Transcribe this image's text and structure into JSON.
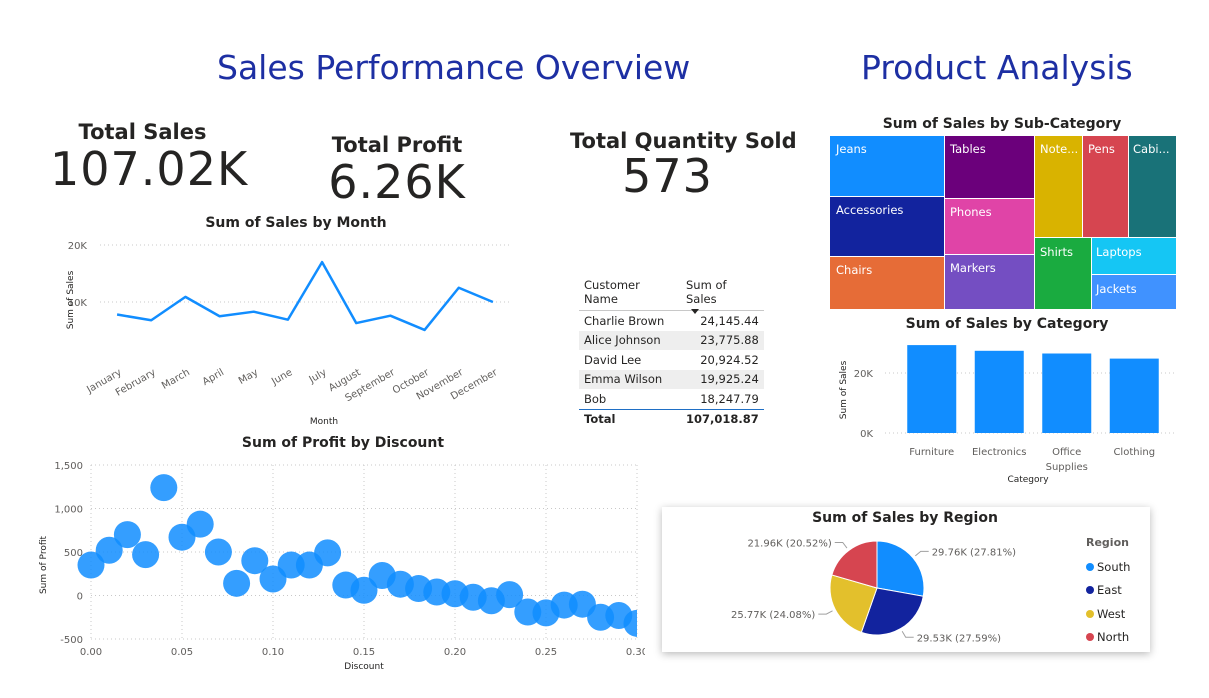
{
  "headers": {
    "left": "Sales Performance Overview",
    "right": "Product Analysis"
  },
  "cards": [
    {
      "label": "Total Sales",
      "value": "107.02K"
    },
    {
      "label": "Total Profit",
      "value": "6.26K"
    },
    {
      "label": "Total Quantity Sold",
      "value": "573"
    }
  ],
  "customer_table": {
    "headers": [
      "Customer Name",
      "Sum of Sales"
    ],
    "rows": [
      {
        "name": "Charlie Brown",
        "sales": "24,145.44"
      },
      {
        "name": "Alice Johnson",
        "sales": "23,775.88"
      },
      {
        "name": "David Lee",
        "sales": "20,924.52"
      },
      {
        "name": "Emma Wilson",
        "sales": "19,925.24"
      },
      {
        "name": "Bob",
        "sales": "18,247.79"
      }
    ],
    "total": {
      "label": "Total",
      "value": "107,018.87"
    }
  },
  "colors": {
    "primary": "#118dff",
    "title_blue": "#1d2fa3",
    "dark_blue": "#12239e",
    "yellow": "#e3c02c",
    "red": "#d64550"
  },
  "chart_data": [
    {
      "id": "monthly",
      "type": "line",
      "title": "Sum of Sales by Month",
      "xlabel": "Month",
      "ylabel": "Sum of Sales",
      "categories": [
        "January",
        "February",
        "March",
        "April",
        "May",
        "June",
        "July",
        "August",
        "September",
        "October",
        "November",
        "December"
      ],
      "values": [
        7800,
        6800,
        10900,
        7500,
        8300,
        6900,
        17000,
        6300,
        7600,
        5100,
        12500,
        10000
      ],
      "ylim": [
        0,
        20000
      ],
      "yticks": [
        {
          "v": 10000,
          "label": "10K"
        },
        {
          "v": 20000,
          "label": "20K"
        }
      ],
      "grid": true,
      "color": "#118dff"
    },
    {
      "id": "discount",
      "type": "scatter",
      "title": "Sum of Profit by Discount",
      "xlabel": "Discount",
      "ylabel": "Sum of Profit",
      "xlim": [
        0,
        0.3
      ],
      "ylim": [
        -500,
        1500
      ],
      "xticks": [
        {
          "v": 0,
          "label": "0.00"
        },
        {
          "v": 0.05,
          "label": "0.05"
        },
        {
          "v": 0.1,
          "label": "0.10"
        },
        {
          "v": 0.15,
          "label": "0.15"
        },
        {
          "v": 0.2,
          "label": "0.20"
        },
        {
          "v": 0.25,
          "label": "0.25"
        },
        {
          "v": 0.3,
          "label": "0.30"
        }
      ],
      "yticks": [
        {
          "v": -500,
          "label": "-500"
        },
        {
          "v": 0,
          "label": "0"
        },
        {
          "v": 500,
          "label": "500"
        },
        {
          "v": 1000,
          "label": "1,000"
        },
        {
          "v": 1500,
          "label": "1,500"
        }
      ],
      "grid": true,
      "color": "#118dff",
      "points": [
        {
          "x": 0.0,
          "y": 350
        },
        {
          "x": 0.01,
          "y": 520
        },
        {
          "x": 0.02,
          "y": 700
        },
        {
          "x": 0.03,
          "y": 470
        },
        {
          "x": 0.04,
          "y": 1240
        },
        {
          "x": 0.05,
          "y": 670
        },
        {
          "x": 0.06,
          "y": 820
        },
        {
          "x": 0.07,
          "y": 500
        },
        {
          "x": 0.08,
          "y": 140
        },
        {
          "x": 0.09,
          "y": 400
        },
        {
          "x": 0.1,
          "y": 190
        },
        {
          "x": 0.11,
          "y": 350
        },
        {
          "x": 0.12,
          "y": 350
        },
        {
          "x": 0.13,
          "y": 490
        },
        {
          "x": 0.14,
          "y": 120
        },
        {
          "x": 0.15,
          "y": 60
        },
        {
          "x": 0.16,
          "y": 230
        },
        {
          "x": 0.17,
          "y": 130
        },
        {
          "x": 0.18,
          "y": 80
        },
        {
          "x": 0.19,
          "y": 40
        },
        {
          "x": 0.2,
          "y": 20
        },
        {
          "x": 0.21,
          "y": -20
        },
        {
          "x": 0.22,
          "y": -60
        },
        {
          "x": 0.23,
          "y": 10
        },
        {
          "x": 0.24,
          "y": -190
        },
        {
          "x": 0.25,
          "y": -200
        },
        {
          "x": 0.26,
          "y": -110
        },
        {
          "x": 0.27,
          "y": -100
        },
        {
          "x": 0.28,
          "y": -250
        },
        {
          "x": 0.29,
          "y": -230
        },
        {
          "x": 0.3,
          "y": -320
        }
      ]
    },
    {
      "id": "subcategory",
      "type": "treemap",
      "title": "Sum of Sales by Sub-Category",
      "items": [
        {
          "label": "Jeans",
          "color": "#118dff"
        },
        {
          "label": "Accessories",
          "color": "#12239e"
        },
        {
          "label": "Chairs",
          "color": "#e66c37"
        },
        {
          "label": "Tables",
          "color": "#6b007b"
        },
        {
          "label": "Phones",
          "color": "#e044a7"
        },
        {
          "label": "Markers",
          "color": "#744ec2"
        },
        {
          "label": "Note...",
          "color": "#d9b300"
        },
        {
          "label": "Pens",
          "color": "#d64550"
        },
        {
          "label": "Cabi...",
          "color": "#197278"
        },
        {
          "label": "Shirts",
          "color": "#1aab40"
        },
        {
          "label": "Laptops",
          "color": "#15c6f4"
        },
        {
          "label": "Jackets",
          "color": "#4092ff"
        }
      ]
    },
    {
      "id": "category",
      "type": "bar",
      "title": "Sum of Sales by Category",
      "xlabel": "Category",
      "ylabel": "Sum of Sales",
      "categories": [
        "Furniture",
        "Electronics",
        "Office Supplies",
        "Clothing"
      ],
      "values": [
        29300,
        27400,
        26500,
        24800
      ],
      "ylim": [
        0,
        30000
      ],
      "yticks": [
        {
          "v": 0,
          "label": "0K"
        },
        {
          "v": 20000,
          "label": "20K"
        }
      ],
      "grid": true,
      "color": "#118dff"
    },
    {
      "id": "region",
      "type": "pie",
      "title": "Sum of Sales by Region",
      "legend_title": "Region",
      "legend_position": "right",
      "slices": [
        {
          "name": "South",
          "value": 29.76,
          "label": "29.76K (27.81%)",
          "color": "#118dff"
        },
        {
          "name": "East",
          "value": 29.53,
          "label": "29.53K (27.59%)",
          "color": "#12239e"
        },
        {
          "name": "West",
          "value": 25.77,
          "label": "25.77K (24.08%)",
          "color": "#e3c02c"
        },
        {
          "name": "North",
          "value": 21.96,
          "label": "21.96K (20.52%)",
          "color": "#d64550"
        }
      ]
    }
  ]
}
